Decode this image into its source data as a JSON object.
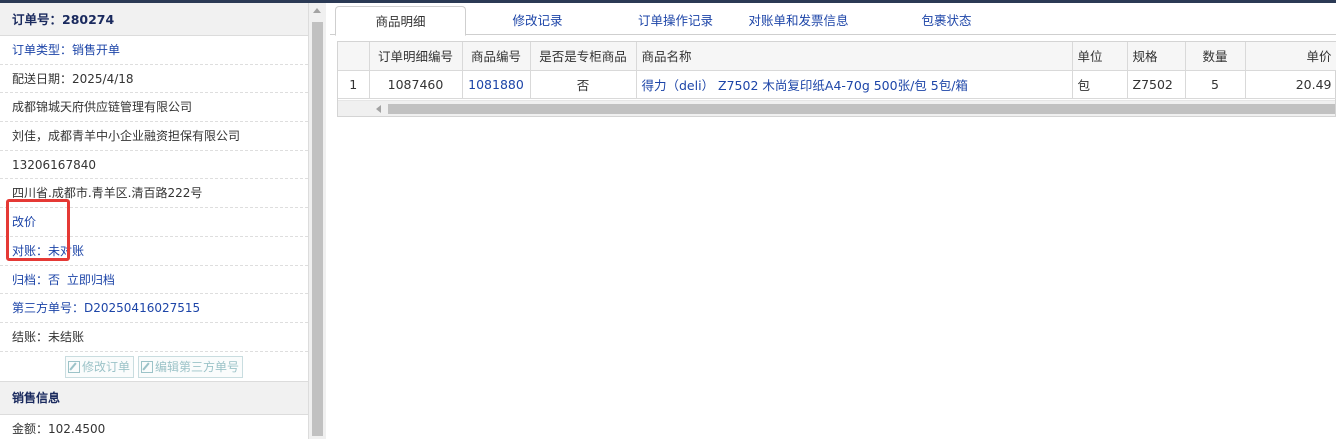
{
  "order": {
    "header_label": "订单号：280274",
    "type_label": "订单类型：",
    "type_value": "销售开单",
    "delivery_date": "配送日期：2025/4/18",
    "company": "成都锦城天府供应链管理有限公司",
    "contact": "刘佳，成都青羊中小企业融资担保有限公司",
    "phone": "13206167840",
    "address": "四川省.成都市.青羊区.清百路222号",
    "reprice_link": "改价",
    "reconcile_label": "对账：",
    "reconcile_value": "未对账",
    "archive_label": "归档：",
    "archive_value": "否",
    "archive_action": "立即归档",
    "third_party_label": "第三方单号：",
    "third_party_value": "D20250416027515",
    "settle_label": "结账：",
    "settle_value": "未结账",
    "edit_order_button": "修改订单",
    "edit_third_party_button": "编辑第三方单号",
    "sales_section": "销售信息",
    "amount": "金额：102.4500"
  },
  "tabs": [
    {
      "label": "商品明细",
      "active": true
    },
    {
      "label": "修改记录",
      "active": false
    },
    {
      "label": "订单操作记录",
      "active": false
    },
    {
      "label": "对账单和发票信息",
      "active": false
    },
    {
      "label": "包裹状态",
      "active": false
    }
  ],
  "table": {
    "columns": [
      "",
      "订单明细编号",
      "商品编号",
      "是否是专柜商品",
      "商品名称",
      "单位",
      "规格",
      "数量",
      "单价"
    ],
    "rows": [
      {
        "index": "1",
        "detail_id": "1087460",
        "product_id": "1081880",
        "is_counter": "否",
        "name": "得力（deli） Z7502 木尚复印纸A4-70g 500张/包 5包/箱",
        "unit": "包",
        "spec": "Z7502",
        "qty": "5",
        "price": "20.49"
      }
    ]
  },
  "colors": {
    "link_blue": "#1d45a8",
    "header_navy": "#1a2a5e",
    "highlight_red": "#e53935"
  }
}
